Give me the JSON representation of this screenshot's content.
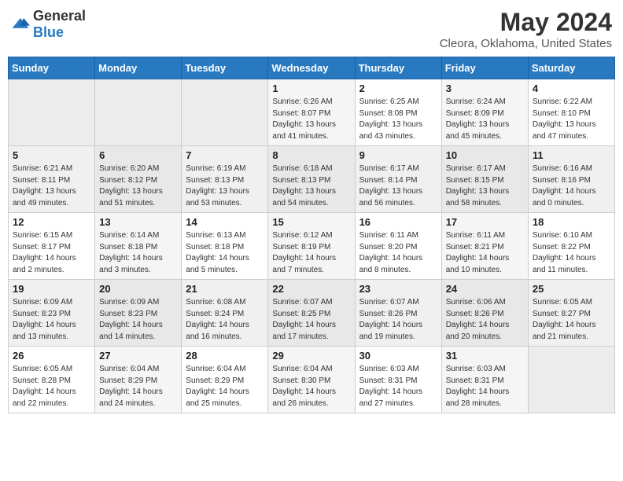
{
  "header": {
    "logo_general": "General",
    "logo_blue": "Blue",
    "month_year": "May 2024",
    "location": "Cleora, Oklahoma, United States"
  },
  "days_of_week": [
    "Sunday",
    "Monday",
    "Tuesday",
    "Wednesday",
    "Thursday",
    "Friday",
    "Saturday"
  ],
  "weeks": [
    [
      {
        "day": "",
        "empty": true
      },
      {
        "day": "",
        "empty": true
      },
      {
        "day": "",
        "empty": true
      },
      {
        "day": "1",
        "sunrise": "6:26 AM",
        "sunset": "8:07 PM",
        "daylight": "13 hours and 41 minutes."
      },
      {
        "day": "2",
        "sunrise": "6:25 AM",
        "sunset": "8:08 PM",
        "daylight": "13 hours and 43 minutes."
      },
      {
        "day": "3",
        "sunrise": "6:24 AM",
        "sunset": "8:09 PM",
        "daylight": "13 hours and 45 minutes."
      },
      {
        "day": "4",
        "sunrise": "6:22 AM",
        "sunset": "8:10 PM",
        "daylight": "13 hours and 47 minutes."
      }
    ],
    [
      {
        "day": "5",
        "sunrise": "6:21 AM",
        "sunset": "8:11 PM",
        "daylight": "13 hours and 49 minutes."
      },
      {
        "day": "6",
        "sunrise": "6:20 AM",
        "sunset": "8:12 PM",
        "daylight": "13 hours and 51 minutes."
      },
      {
        "day": "7",
        "sunrise": "6:19 AM",
        "sunset": "8:13 PM",
        "daylight": "13 hours and 53 minutes."
      },
      {
        "day": "8",
        "sunrise": "6:18 AM",
        "sunset": "8:13 PM",
        "daylight": "13 hours and 54 minutes."
      },
      {
        "day": "9",
        "sunrise": "6:17 AM",
        "sunset": "8:14 PM",
        "daylight": "13 hours and 56 minutes."
      },
      {
        "day": "10",
        "sunrise": "6:17 AM",
        "sunset": "8:15 PM",
        "daylight": "13 hours and 58 minutes."
      },
      {
        "day": "11",
        "sunrise": "6:16 AM",
        "sunset": "8:16 PM",
        "daylight": "14 hours and 0 minutes."
      }
    ],
    [
      {
        "day": "12",
        "sunrise": "6:15 AM",
        "sunset": "8:17 PM",
        "daylight": "14 hours and 2 minutes."
      },
      {
        "day": "13",
        "sunrise": "6:14 AM",
        "sunset": "8:18 PM",
        "daylight": "14 hours and 3 minutes."
      },
      {
        "day": "14",
        "sunrise": "6:13 AM",
        "sunset": "8:18 PM",
        "daylight": "14 hours and 5 minutes."
      },
      {
        "day": "15",
        "sunrise": "6:12 AM",
        "sunset": "8:19 PM",
        "daylight": "14 hours and 7 minutes."
      },
      {
        "day": "16",
        "sunrise": "6:11 AM",
        "sunset": "8:20 PM",
        "daylight": "14 hours and 8 minutes."
      },
      {
        "day": "17",
        "sunrise": "6:11 AM",
        "sunset": "8:21 PM",
        "daylight": "14 hours and 10 minutes."
      },
      {
        "day": "18",
        "sunrise": "6:10 AM",
        "sunset": "8:22 PM",
        "daylight": "14 hours and 11 minutes."
      }
    ],
    [
      {
        "day": "19",
        "sunrise": "6:09 AM",
        "sunset": "8:23 PM",
        "daylight": "14 hours and 13 minutes."
      },
      {
        "day": "20",
        "sunrise": "6:09 AM",
        "sunset": "8:23 PM",
        "daylight": "14 hours and 14 minutes."
      },
      {
        "day": "21",
        "sunrise": "6:08 AM",
        "sunset": "8:24 PM",
        "daylight": "14 hours and 16 minutes."
      },
      {
        "day": "22",
        "sunrise": "6:07 AM",
        "sunset": "8:25 PM",
        "daylight": "14 hours and 17 minutes."
      },
      {
        "day": "23",
        "sunrise": "6:07 AM",
        "sunset": "8:26 PM",
        "daylight": "14 hours and 19 minutes."
      },
      {
        "day": "24",
        "sunrise": "6:06 AM",
        "sunset": "8:26 PM",
        "daylight": "14 hours and 20 minutes."
      },
      {
        "day": "25",
        "sunrise": "6:05 AM",
        "sunset": "8:27 PM",
        "daylight": "14 hours and 21 minutes."
      }
    ],
    [
      {
        "day": "26",
        "sunrise": "6:05 AM",
        "sunset": "8:28 PM",
        "daylight": "14 hours and 22 minutes."
      },
      {
        "day": "27",
        "sunrise": "6:04 AM",
        "sunset": "8:29 PM",
        "daylight": "14 hours and 24 minutes."
      },
      {
        "day": "28",
        "sunrise": "6:04 AM",
        "sunset": "8:29 PM",
        "daylight": "14 hours and 25 minutes."
      },
      {
        "day": "29",
        "sunrise": "6:04 AM",
        "sunset": "8:30 PM",
        "daylight": "14 hours and 26 minutes."
      },
      {
        "day": "30",
        "sunrise": "6:03 AM",
        "sunset": "8:31 PM",
        "daylight": "14 hours and 27 minutes."
      },
      {
        "day": "31",
        "sunrise": "6:03 AM",
        "sunset": "8:31 PM",
        "daylight": "14 hours and 28 minutes."
      },
      {
        "day": "",
        "empty": true
      }
    ]
  ],
  "labels": {
    "sunrise": "Sunrise:",
    "sunset": "Sunset:",
    "daylight": "Daylight:"
  }
}
